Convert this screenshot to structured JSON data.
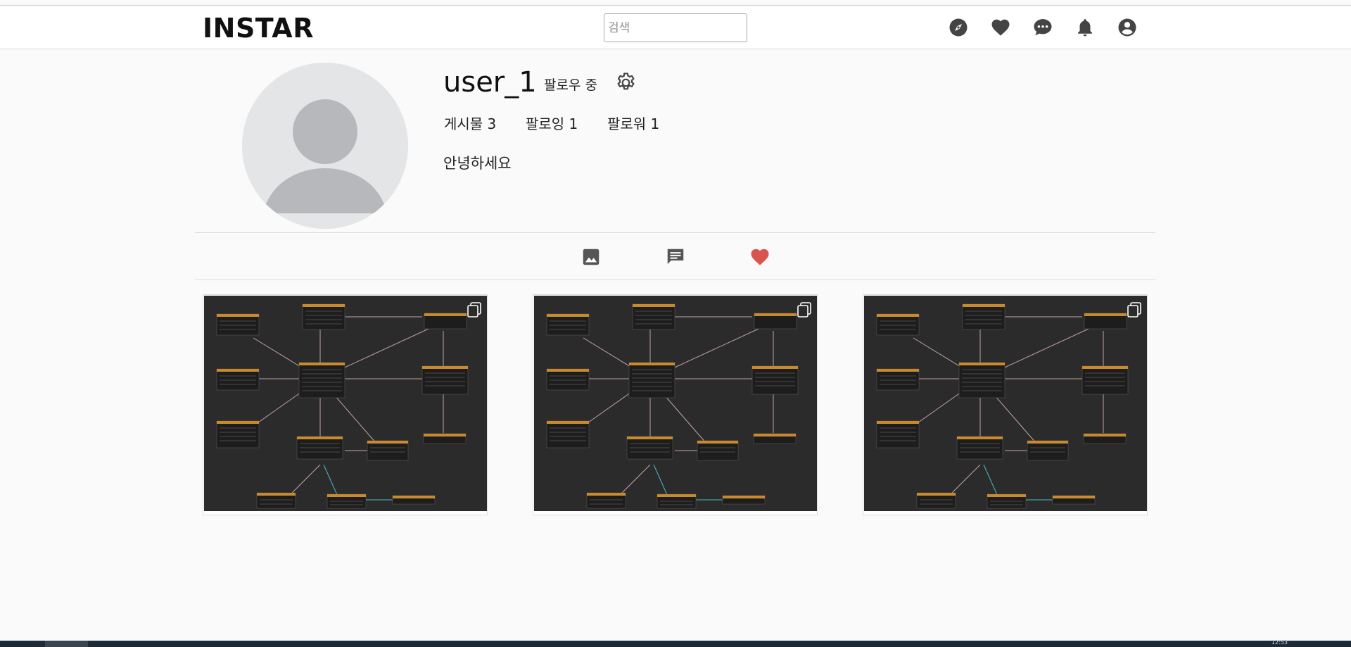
{
  "header": {
    "logo": "INSTAR",
    "search_placeholder": "검색",
    "search_value": "",
    "nav_icons": [
      "explore-icon",
      "heart-icon",
      "chat-icon",
      "bell-icon",
      "account-icon"
    ]
  },
  "profile": {
    "username": "user_1",
    "follow_status": "팔로우 중",
    "stats": {
      "posts": "게시물 3",
      "following": "팔로잉 1",
      "followers": "팔로워 1"
    },
    "bio": "안녕하세요"
  },
  "tabs": [
    {
      "name": "posts",
      "icon": "image-icon",
      "active": false
    },
    {
      "name": "comments",
      "icon": "comment-icon",
      "active": false
    },
    {
      "name": "likes",
      "icon": "heart-icon",
      "active": true
    }
  ],
  "posts": [
    {
      "thumbnail": "database-diagram",
      "multiple_images": true
    },
    {
      "thumbnail": "database-diagram",
      "multiple_images": true
    },
    {
      "thumbnail": "database-diagram",
      "multiple_images": true
    }
  ],
  "colors": {
    "background": "#fafafa",
    "border": "#dbdbdb",
    "icon": "#444444",
    "liked": "#d9534f",
    "thumb_bg": "#2b2b2b"
  },
  "taskbar": {
    "clock": "12:53"
  }
}
